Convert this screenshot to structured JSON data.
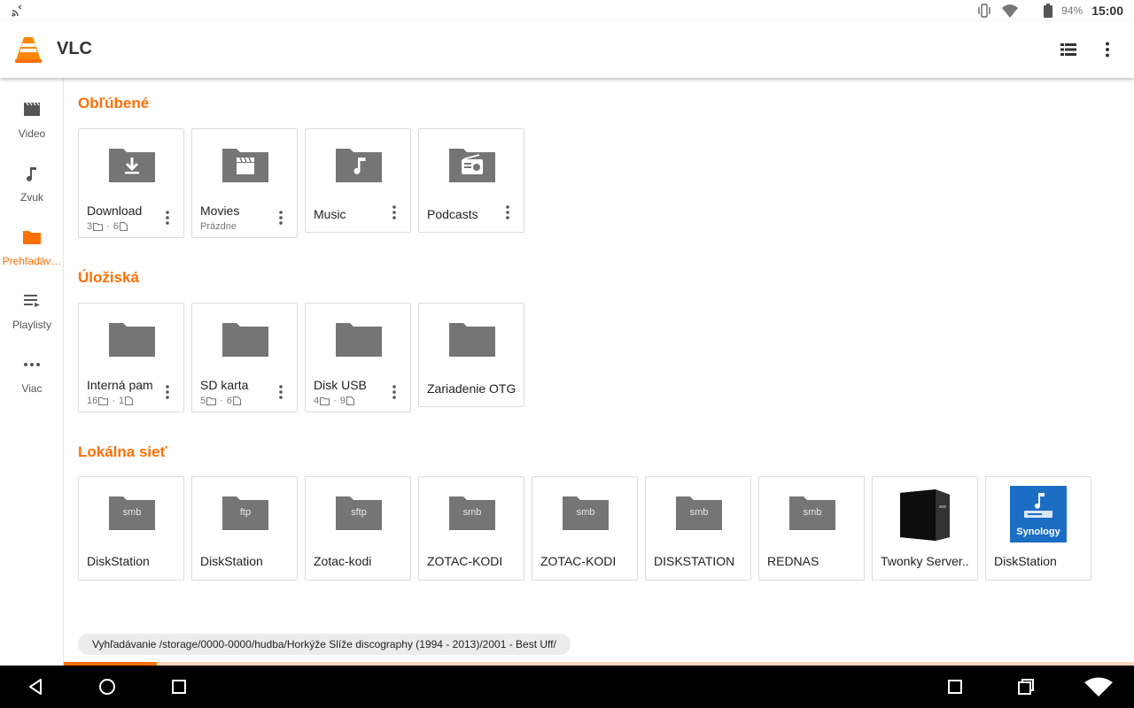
{
  "status_bar": {
    "battery_percent": "94%",
    "clock": "15:00",
    "icons": [
      "cast-icon",
      "vibrate-icon",
      "wifi-icon",
      "battery-icon"
    ]
  },
  "app_bar": {
    "title": "VLC",
    "actions": [
      "list-view-icon",
      "more-vert-icon"
    ]
  },
  "nav": {
    "items": [
      {
        "label": "Video",
        "icon": "movie-icon"
      },
      {
        "label": "Zvuk",
        "icon": "music-note-icon"
      },
      {
        "label": "Prehľadáv…",
        "icon": "folder-icon",
        "active": true
      },
      {
        "label": "Playlisty",
        "icon": "playlist-icon"
      },
      {
        "label": "Viac",
        "icon": "more-horiz-icon"
      }
    ]
  },
  "sections": {
    "favorites": {
      "title": "Obľúbené",
      "items": [
        {
          "title": "Download",
          "folders": "3",
          "files": "6",
          "icon": "download-icon"
        },
        {
          "title": "Movies",
          "subtitle": "Prázdne",
          "icon": "clapperboard-icon"
        },
        {
          "title": "Music",
          "icon": "music-note-icon"
        },
        {
          "title": "Podcasts",
          "icon": "radio-icon"
        }
      ]
    },
    "storages": {
      "title": "Úložiská",
      "items": [
        {
          "title": "Interná pam",
          "folders": "16",
          "files": "1"
        },
        {
          "title": "SD karta",
          "folders": "5",
          "files": "6"
        },
        {
          "title": "Disk USB",
          "folders": "4",
          "files": "9"
        },
        {
          "title": "Zariadenie OTG"
        }
      ]
    },
    "network": {
      "title": "Lokálna sieť",
      "items": [
        {
          "title": "DiskStation",
          "protocol": "smb"
        },
        {
          "title": "DiskStation",
          "protocol": "ftp"
        },
        {
          "title": "Zotac-kodi",
          "protocol": "sftp"
        },
        {
          "title": "ZOTAC-KODI",
          "protocol": "smb"
        },
        {
          "title": "ZOTAC-KODI",
          "protocol": "smb"
        },
        {
          "title": "DISKSTATION",
          "protocol": "smb"
        },
        {
          "title": "REDNAS",
          "protocol": "smb"
        },
        {
          "title": "Twonky Server..",
          "thumbnail": "nas-device-icon"
        },
        {
          "title": "DiskStation",
          "thumbnail": "synology-logo-icon",
          "logo_text": "Synology"
        }
      ]
    }
  },
  "search_status": "Vyhľadávanie /storage/0000-0000/hudba/Horkýže Slíže discography (1994 - 2013)/2001 - Best Uff/",
  "progress_fraction": 0.087,
  "colors": {
    "accent": "#ff6f00",
    "folder": "#757575",
    "progress_track": "#ffd7c0"
  },
  "system_nav": [
    "back-icon",
    "home-icon",
    "recents-icon",
    "screenshot-icon",
    "windows-icon",
    "wifi-icon"
  ]
}
